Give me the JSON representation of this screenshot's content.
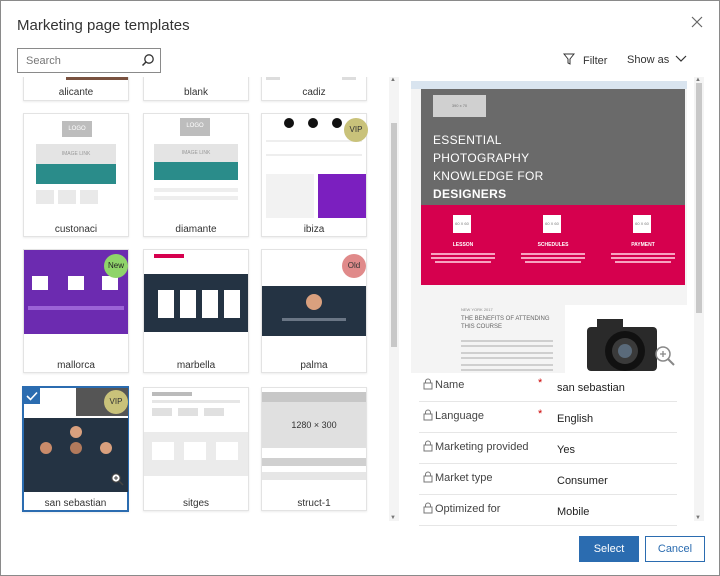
{
  "dialog": {
    "title": "Marketing page templates",
    "close_icon": "close-icon"
  },
  "toolbar": {
    "search_placeholder": "Search",
    "filter_label": "Filter",
    "showas_label": "Show as"
  },
  "templates": [
    {
      "label": "alicante"
    },
    {
      "label": "blank"
    },
    {
      "label": "cadiz"
    },
    {
      "label": "custonaci",
      "thumb_text": [
        "LOGO",
        "IMAGE LINK"
      ]
    },
    {
      "label": "diamante",
      "thumb_text": [
        "LOGO",
        "IMAGE LINK"
      ]
    },
    {
      "label": "ibiza",
      "badge": "VIP"
    },
    {
      "label": "mallorca",
      "badge": "New"
    },
    {
      "label": "marbella"
    },
    {
      "label": "palma",
      "badge": "Old"
    },
    {
      "label": "san sebastian",
      "badge": "VIP",
      "selected": true
    },
    {
      "label": "sitges"
    },
    {
      "label": "struct-1",
      "thumb_text": "1280 × 300"
    }
  ],
  "preview": {
    "imgbox": "390 x 70",
    "headline": [
      "ESSENTIAL",
      "PHOTOGRAPHY",
      "KNOWLEDGE FOR"
    ],
    "headline_bold": "DESIGNERS",
    "features": [
      {
        "label": "LESSON",
        "img": "60 X 60"
      },
      {
        "label": "SCHEDULES",
        "img": "60 X 60"
      },
      {
        "label": "PAYMENT",
        "img": "60 X 60"
      }
    ],
    "ny": "NEW YORK 2017",
    "benefits": "THE BENEFITS OF ATTENDING THIS COURSE",
    "benefits_bold": "BENEFITS"
  },
  "properties": [
    {
      "label": "Name",
      "required": true,
      "value": "san sebastian"
    },
    {
      "label": "Language",
      "required": true,
      "value": "English"
    },
    {
      "label": "Marketing provided",
      "required": false,
      "value": "Yes"
    },
    {
      "label": "Market type",
      "required": false,
      "value": "Consumer"
    },
    {
      "label": "Optimized for",
      "required": false,
      "value": "Mobile"
    }
  ],
  "buttons": {
    "select": "Select",
    "cancel": "Cancel"
  },
  "colors": {
    "accent": "#2b6cb0",
    "teal": "#2a8c8a",
    "pink": "#d6004e",
    "purple": "#7b1fbf",
    "dark": "#243343",
    "vip": "#c9c27a",
    "new": "#8fd46a",
    "old": "#e08a8a"
  }
}
